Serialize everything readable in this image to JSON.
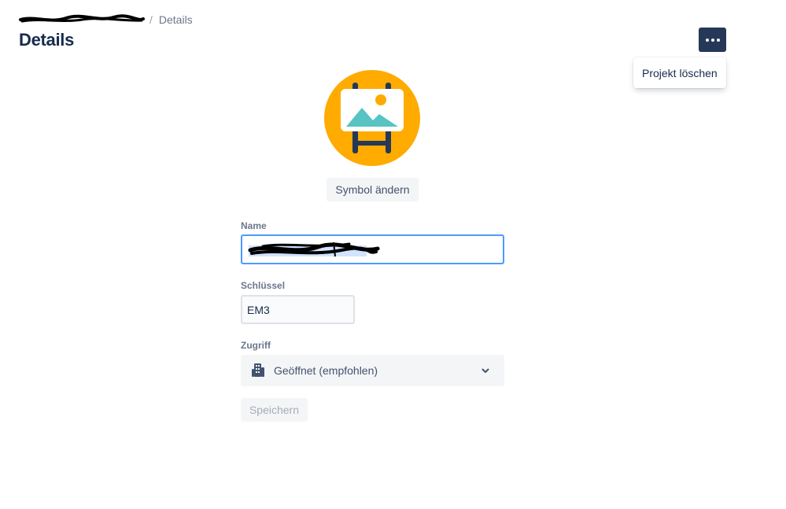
{
  "breadcrumb": {
    "parent": "",
    "separator": "/",
    "current": "Details"
  },
  "page": {
    "title": "Details"
  },
  "menu": {
    "items": [
      {
        "label": "Projekt löschen"
      }
    ]
  },
  "project": {
    "change_icon_label": "Symbol ändern"
  },
  "form": {
    "name": {
      "label": "Name",
      "value": ""
    },
    "key": {
      "label": "Schlüssel",
      "value": "EM3"
    },
    "access": {
      "label": "Zugriff",
      "value": "Geöffnet (empfohlen)"
    },
    "save_label": "Speichern"
  },
  "colors": {
    "primary_dark": "#253858",
    "avatar_bg": "#ffab00",
    "focus_border": "#4c9aff",
    "text_primary": "#172b4d",
    "text_subtle": "#6b778c"
  },
  "icons": {
    "more": "more-horizontal-icon",
    "avatar": "easel-picture-icon",
    "access": "building-icon",
    "chevron": "chevron-down-icon"
  }
}
